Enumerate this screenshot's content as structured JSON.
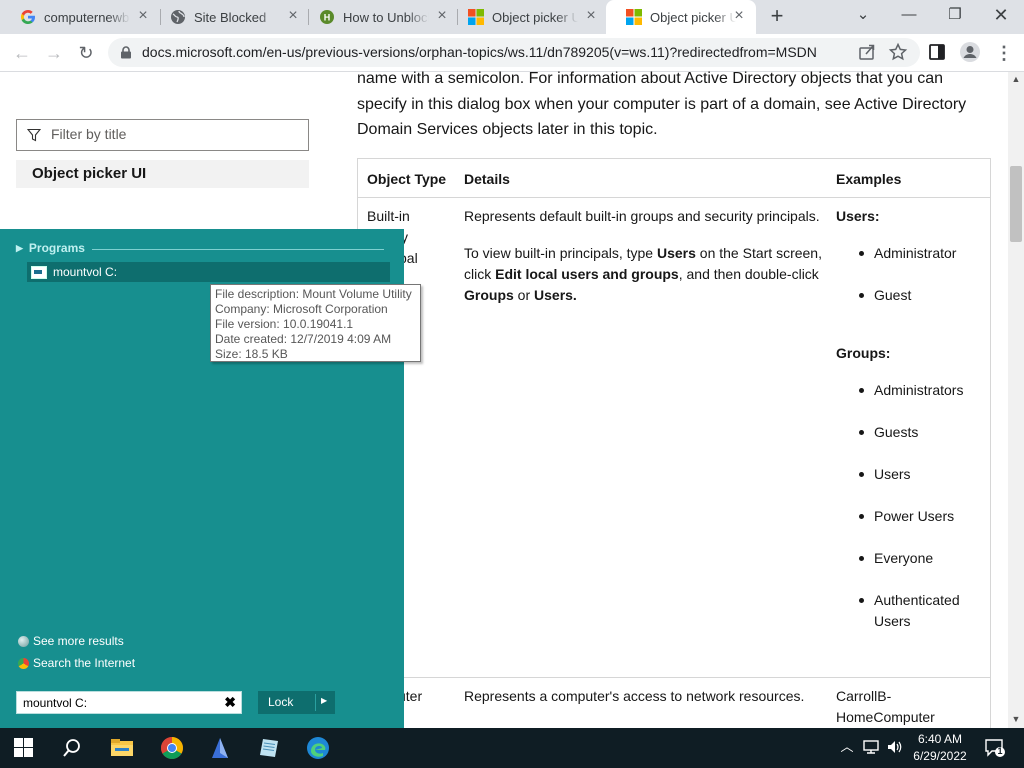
{
  "browser": {
    "tabs": [
      {
        "label": "computernewb",
        "icon": "google-icon",
        "active": false
      },
      {
        "label": "Site Blocked",
        "icon": "globe-icon",
        "active": false
      },
      {
        "label": "How to Unblock",
        "icon": "site-favicon-icon",
        "active": false
      },
      {
        "label": "Object picker UI",
        "icon": "microsoft-icon",
        "active": false
      },
      {
        "label": "Object picker UI",
        "icon": "microsoft-icon",
        "active": true
      }
    ],
    "url": "docs.microsoft.com/en-us/previous-versions/orphan-topics/ws.11/dn789205(v=ws.11)?redirectedfrom=MSDN"
  },
  "sidebar": {
    "filter_placeholder": "Filter by title",
    "toc_item": "Object picker UI"
  },
  "article": {
    "intro": "name with a semicolon. For information about Active Directory objects that you can specify in this dialog box when your computer is part of a domain, see Active Directory Domain Services objects later in this topic.",
    "table": {
      "headers": [
        "Object Type",
        "Details",
        "Examples"
      ],
      "row1": {
        "type_lines": [
          "Built-in",
          "ity",
          "pal"
        ],
        "details_1": "Represents default built-in groups and security principals.",
        "details_2a": "To view built-in principals, type ",
        "details_2b": "Users",
        "details_2c": " on the Start screen, click ",
        "details_2d": "Edit local users and groups",
        "details_2e": ", and then double-click ",
        "details_2f": "Groups",
        "details_2g": " or ",
        "details_2h": "Users.",
        "users_label": "Users:",
        "users": [
          "Administrator",
          "Guest"
        ],
        "groups_label": "Groups:",
        "groups": [
          "Administrators",
          "Guests",
          "Users",
          "Power Users",
          "Everyone",
          "Authenticated Users"
        ]
      },
      "row2": {
        "type": "uter",
        "details": "Represents a computer's access to network resources.",
        "example_1": "CarrollB-",
        "example_2": "HomeComputer"
      }
    }
  },
  "startmenu": {
    "section": "Programs",
    "result": "mountvol C:",
    "see_more": "See more results",
    "search_internet": "Search the Internet",
    "search_value": "mountvol C:",
    "lock_label": "Lock",
    "colors": {
      "background": "#178f8f",
      "highlight": "#0e6e6e"
    }
  },
  "tooltip": {
    "lines": [
      "File description: Mount Volume Utility",
      "Company: Microsoft Corporation",
      "File version: 10.0.19041.1",
      "Date created: 12/7/2019 4:09 AM",
      "Size: 18.5 KB"
    ]
  },
  "taskbar": {
    "time": "6:40 AM",
    "date": "6/29/2022",
    "notification_count": "1",
    "apps": [
      "windows-start-icon",
      "search-icon",
      "file-explorer-icon",
      "chrome-icon",
      "app-icon",
      "notepad-icon",
      "edge-icon"
    ]
  }
}
